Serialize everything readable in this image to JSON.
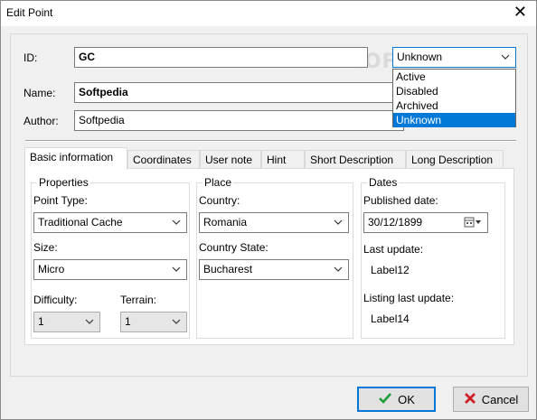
{
  "window": {
    "title": "Edit Point"
  },
  "fields": {
    "id_label": "ID:",
    "id_value": "GC",
    "status_value": "Unknown",
    "status_options": [
      "Active",
      "Disabled",
      "Archived",
      "Unknown"
    ],
    "name_label": "Name:",
    "name_value": "Softpedia",
    "author_label": "Author:",
    "author_value": "Softpedia"
  },
  "tabs": [
    "Basic information",
    "Coordinates",
    "User note",
    "Hint",
    "Short Description",
    "Long Description"
  ],
  "properties": {
    "title": "Properties",
    "point_type_label": "Point Type:",
    "point_type_value": "Traditional Cache",
    "size_label": "Size:",
    "size_value": "Micro",
    "difficulty_label": "Difficulty:",
    "difficulty_value": "1",
    "terrain_label": "Terrain:",
    "terrain_value": "1"
  },
  "place": {
    "title": "Place",
    "country_label": "Country:",
    "country_value": "Romania",
    "state_label": "Country State:",
    "state_value": "Bucharest"
  },
  "dates": {
    "title": "Dates",
    "published_label": "Published date:",
    "published_value": "30/12/1899",
    "last_update_label": "Last update:",
    "last_update_value": "Label12",
    "listing_label": "Listing last update:",
    "listing_value": "Label14"
  },
  "buttons": {
    "ok": "OK",
    "cancel": "Cancel"
  },
  "watermark": "SOFTPEDIA",
  "colors": {
    "accent": "#0078d7",
    "ok_check": "#1e9e3a",
    "cancel_x": "#d0202a"
  }
}
